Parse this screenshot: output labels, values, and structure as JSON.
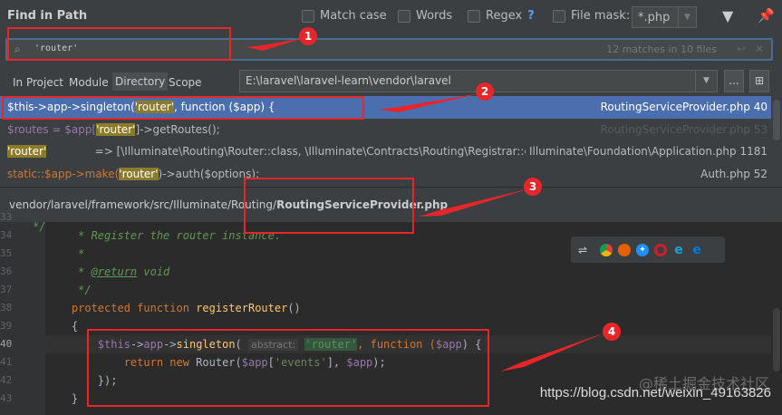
{
  "title": "Find in Path",
  "options": {
    "match_case": "Match case",
    "words": "Words",
    "regex": "Regex",
    "regex_help": "?",
    "file_mask": "File mask:",
    "file_mask_value": "*.php"
  },
  "search": {
    "value": "'router'",
    "count": "12 matches in 10 files"
  },
  "scopes": [
    "In Project",
    "Module",
    "Directory",
    "Scope"
  ],
  "selected_scope": "Directory",
  "directory": "E:\\laravel\\laravel-learn\\vendor\\laravel",
  "browse_label": "...",
  "results": [
    {
      "pre": "$this->app->singleton(",
      "match": "'router'",
      "post": ", function ($app) {",
      "file": "RoutingServiceProvider.php 40"
    },
    {
      "pre": "$routes = $app[",
      "match": "'router'",
      "post": "]->getRoutes();",
      "file": "RoutingServiceProvider.php 53"
    },
    {
      "pre": "",
      "match": "'router'",
      "post": "              => [\\Illuminate\\Routing\\Router::class, \\Illuminate\\Contracts\\Routing\\Registrar::class",
      "file": "Illuminate\\Foundation\\Application.php 1181"
    },
    {
      "pre": "static::$app->make(",
      "match": "'router'",
      "post": ")->auth($options);",
      "file": "Auth.php 52"
    }
  ],
  "path": {
    "dir": "vendor/laravel/framework/src/Illuminate/Routing/",
    "file": "RoutingServiceProvider.php"
  },
  "code": {
    "lines": [
      "33",
      "34",
      "35",
      "36",
      "37",
      "38",
      "39",
      "40",
      "41",
      "42",
      "43"
    ],
    "l33": "     */",
    "l34": "     * Register the router instance.",
    "l35": "     *",
    "l36a": "     * ",
    "l36b": "@return",
    "l36c": " void",
    "l37": "     */",
    "l38a": "    protected function ",
    "l38b": "registerRouter",
    "l38c": "()",
    "l39": "    {",
    "l40a": "        $this",
    "l40b": "->",
    "l40c": "app",
    "l40d": "->",
    "l40e": "singleton",
    "l40f": "( ",
    "l40hint": "abstract:",
    "l40str": "'router'",
    "l40g": ", function (",
    "l40h": "$app",
    "l40i": ") {",
    "l41a": "            return new ",
    "l41b": "Router(",
    "l41c": "$app",
    "l41d": "[",
    "l41e": "'events'",
    "l41f": "], ",
    "l41g": "$app",
    "l41h": ");",
    "l42": "        });",
    "l43": "    }"
  },
  "browsers": [
    "chrome",
    "firefox",
    "safari",
    "opera",
    "ie",
    "edge"
  ],
  "annotations": [
    "1",
    "2",
    "3",
    "4"
  ],
  "watermark": "https://blog.csdn.net/weixin_49163826",
  "watermark2": "@稀土掘金技术社区",
  "colors": {
    "accent": "#4b6eaf",
    "annotation": "#e8262a",
    "match": "#8c7b2a"
  }
}
